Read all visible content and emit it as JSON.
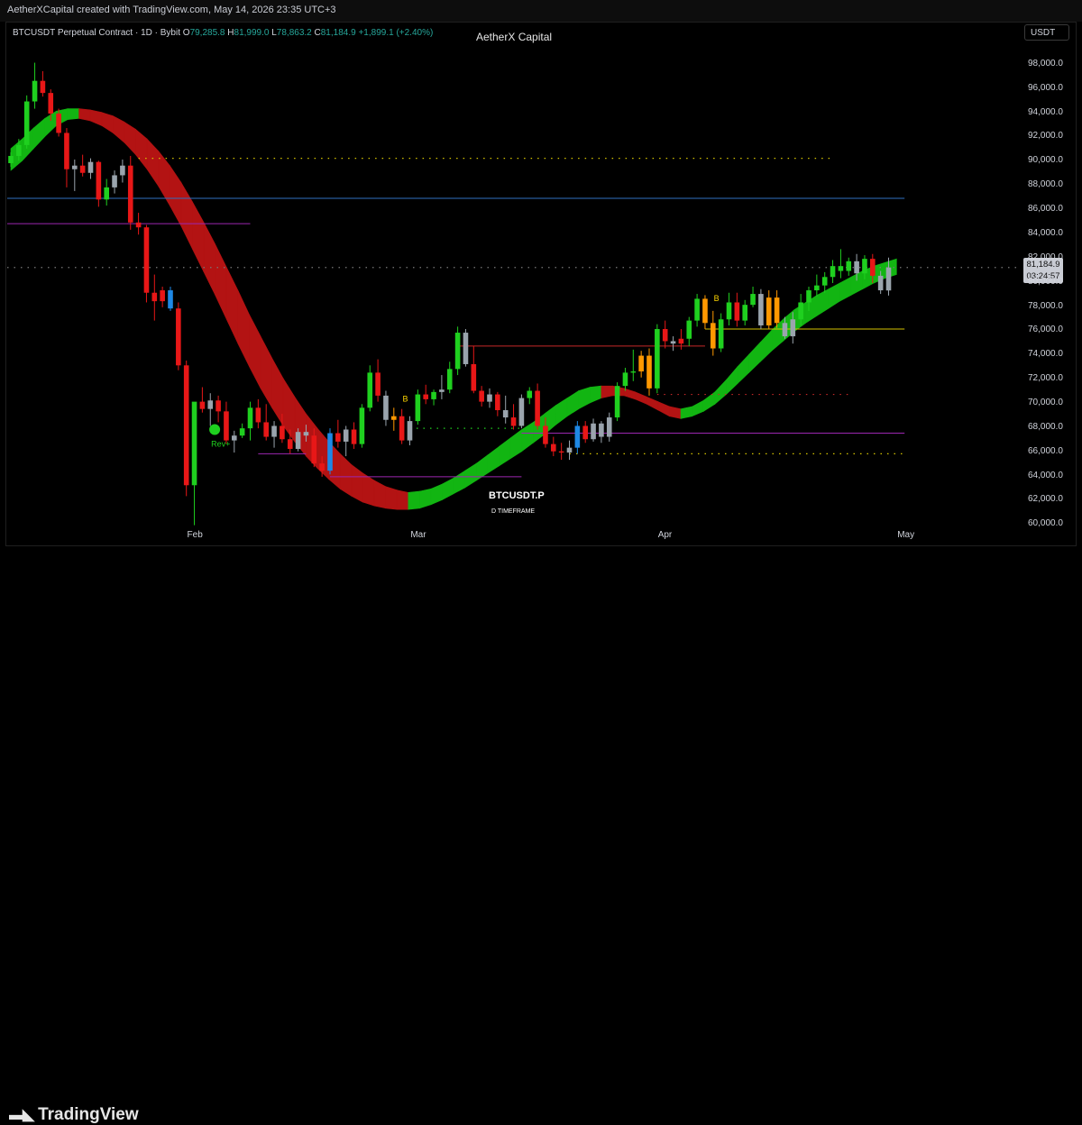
{
  "header": {
    "created_by": "AetherXCapital created with TradingView.com, May 14, 2026 23:35 UTC+3"
  },
  "legend": {
    "symbol": "BTCUSDT Perpetual Contract · 1D · Bybit",
    "open_label": "O",
    "open": "79,285.8",
    "high_label": "H",
    "high": "81,999.0",
    "low_label": "L",
    "low": "78,863.2",
    "close_label": "C",
    "close": "81,184.9",
    "change": "+1,899.1 (+2.40%)"
  },
  "watermark": {
    "brand": "AetherX Capital",
    "symbol": "BTCUSDT.P",
    "timeframe": "D TIMEFRAME"
  },
  "price_scale": {
    "currency": "USDT",
    "last_price": "81,184.9",
    "countdown": "03:24:57"
  },
  "footer": {
    "logo_text": "TradingView"
  },
  "colors": {
    "up": "#1fd01f",
    "down": "#e81717",
    "neutral": "#9aa4ad",
    "blue": "#1e88e5",
    "orange": "#ff9800",
    "ribbon_up": "#12b512",
    "ribbon_down": "#b31313",
    "resistance": "#2f6fbf",
    "purple": "#9c27b0",
    "yellow_dots": "#d4c200",
    "red_dots": "#c62828"
  },
  "chart_data": {
    "type": "candlestick",
    "ylim": [
      59200,
      100300
    ],
    "y_ticks": [
      60000,
      62000,
      64000,
      66000,
      68000,
      70000,
      72000,
      74000,
      76000,
      78000,
      80000,
      82000,
      84000,
      86000,
      88000,
      90000,
      92000,
      94000,
      96000,
      98000
    ],
    "y_tick_labels": [
      "60,000.0",
      "62,000.0",
      "64,000.0",
      "66,000.0",
      "68,000.0",
      "70,000.0",
      "72,000.0",
      "74,000.0",
      "76,000.0",
      "78,000.0",
      "80,000.0",
      "82,000.0",
      "84,000.0",
      "86,000.0",
      "88,000.0",
      "90,000.0",
      "92,000.0",
      "94,000.0",
      "96,000.0",
      "98,000.0"
    ],
    "x_ticks": [
      {
        "label": "Feb",
        "bar": 23
      },
      {
        "label": "Mar",
        "bar": 51
      },
      {
        "label": "Apr",
        "bar": 82
      },
      {
        "label": "May",
        "bar": 112
      }
    ],
    "candles": [
      [
        89800,
        90700,
        89500,
        90400,
        "up"
      ],
      [
        90400,
        91800,
        90000,
        91300,
        "up"
      ],
      [
        91300,
        95400,
        91000,
        94900,
        "up"
      ],
      [
        94900,
        98100,
        94300,
        96600,
        "up"
      ],
      [
        96600,
        97400,
        95300,
        95600,
        "down"
      ],
      [
        95600,
        95900,
        93300,
        93900,
        "down"
      ],
      [
        93900,
        94300,
        92000,
        92300,
        "down"
      ],
      [
        92300,
        92700,
        87800,
        89300,
        "down"
      ],
      [
        89300,
        90100,
        87500,
        89600,
        "neutral"
      ],
      [
        89600,
        90500,
        88700,
        89000,
        "down"
      ],
      [
        89000,
        90200,
        88500,
        89900,
        "neutral"
      ],
      [
        89900,
        90000,
        86200,
        86800,
        "down"
      ],
      [
        86800,
        88500,
        86300,
        87800,
        "up"
      ],
      [
        87800,
        89200,
        87300,
        88800,
        "neutral"
      ],
      [
        88800,
        90100,
        88200,
        89600,
        "neutral"
      ],
      [
        89600,
        90400,
        84300,
        84900,
        "down"
      ],
      [
        84900,
        85700,
        83900,
        84500,
        "down"
      ],
      [
        84500,
        84700,
        78300,
        79100,
        "down"
      ],
      [
        79100,
        80600,
        76800,
        78400,
        "down"
      ],
      [
        78400,
        79600,
        77900,
        79300,
        "down"
      ],
      [
        79300,
        79600,
        77600,
        77800,
        "blue"
      ],
      [
        77800,
        78300,
        72700,
        73100,
        "down"
      ],
      [
        73100,
        73500,
        62300,
        63200,
        "down"
      ],
      [
        63200,
        69900,
        59900,
        70100,
        "up"
      ],
      [
        70100,
        71300,
        69200,
        69500,
        "down"
      ],
      [
        69500,
        70800,
        68100,
        70200,
        "neutral"
      ],
      [
        70200,
        70600,
        68400,
        69300,
        "down"
      ],
      [
        69300,
        70100,
        66600,
        66900,
        "down"
      ],
      [
        66900,
        67700,
        65900,
        67300,
        "neutral"
      ],
      [
        67300,
        68300,
        67100,
        67900,
        "up"
      ],
      [
        67900,
        70100,
        66900,
        69600,
        "up"
      ],
      [
        69600,
        70300,
        67900,
        68400,
        "down"
      ],
      [
        68400,
        69900,
        66900,
        67200,
        "down"
      ],
      [
        67200,
        68500,
        66300,
        68100,
        "neutral"
      ],
      [
        68100,
        69100,
        66700,
        67000,
        "down"
      ],
      [
        67000,
        67800,
        65800,
        66200,
        "down"
      ],
      [
        66200,
        67900,
        66000,
        67600,
        "neutral"
      ],
      [
        67600,
        68200,
        66800,
        67300,
        "neutral"
      ],
      [
        67300,
        67900,
        64700,
        65000,
        "down"
      ],
      [
        65000,
        65600,
        63900,
        64400,
        "down"
      ],
      [
        64400,
        67900,
        64100,
        67500,
        "blue"
      ],
      [
        67500,
        68600,
        66300,
        66800,
        "down"
      ],
      [
        66800,
        68100,
        65600,
        67800,
        "neutral"
      ],
      [
        67800,
        68400,
        66200,
        66600,
        "down"
      ],
      [
        66600,
        69900,
        66300,
        69600,
        "up"
      ],
      [
        69600,
        73100,
        69300,
        72500,
        "up"
      ],
      [
        72500,
        73600,
        70100,
        70600,
        "down"
      ],
      [
        70600,
        71000,
        68100,
        68600,
        "neutral"
      ],
      [
        68600,
        69600,
        67700,
        68900,
        "orange"
      ],
      [
        68900,
        69500,
        66600,
        66900,
        "down"
      ],
      [
        66900,
        68900,
        66500,
        68500,
        "neutral"
      ],
      [
        68500,
        71100,
        68200,
        70700,
        "up"
      ],
      [
        70700,
        71500,
        69900,
        70300,
        "down"
      ],
      [
        70300,
        71100,
        69800,
        70900,
        "up"
      ],
      [
        70900,
        72300,
        70300,
        71100,
        "neutral"
      ],
      [
        71100,
        73400,
        70800,
        72800,
        "up"
      ],
      [
        72800,
        76300,
        72300,
        75800,
        "up"
      ],
      [
        75800,
        76100,
        73000,
        73200,
        "neutral"
      ],
      [
        73200,
        74700,
        70800,
        71000,
        "down"
      ],
      [
        71000,
        71400,
        69700,
        70100,
        "down"
      ],
      [
        70100,
        71200,
        69600,
        70700,
        "neutral"
      ],
      [
        70700,
        70900,
        68900,
        69400,
        "down"
      ],
      [
        69400,
        70600,
        68300,
        68800,
        "neutral"
      ],
      [
        68800,
        69900,
        67800,
        68100,
        "down"
      ],
      [
        68100,
        70700,
        67900,
        70400,
        "neutral"
      ],
      [
        70400,
        71300,
        69900,
        71000,
        "up"
      ],
      [
        71000,
        71600,
        67800,
        68100,
        "down"
      ],
      [
        68100,
        68800,
        66300,
        66600,
        "down"
      ],
      [
        66600,
        67200,
        65600,
        66000,
        "down"
      ],
      [
        66000,
        66700,
        65300,
        65900,
        "down"
      ],
      [
        65900,
        66900,
        65300,
        66300,
        "neutral"
      ],
      [
        66300,
        68500,
        65800,
        68100,
        "blue"
      ],
      [
        68100,
        68500,
        66700,
        67000,
        "down"
      ],
      [
        67000,
        68700,
        66800,
        68300,
        "neutral"
      ],
      [
        68300,
        68500,
        66700,
        67200,
        "neutral"
      ],
      [
        67200,
        69200,
        66800,
        68800,
        "neutral"
      ],
      [
        68800,
        71700,
        68500,
        71400,
        "up"
      ],
      [
        71400,
        72900,
        71000,
        72500,
        "up"
      ],
      [
        72500,
        74400,
        71800,
        72600,
        "up"
      ],
      [
        72600,
        74300,
        72100,
        73900,
        "orange"
      ],
      [
        73900,
        74500,
        70600,
        71200,
        "orange"
      ],
      [
        71200,
        76500,
        70800,
        76100,
        "up"
      ],
      [
        76100,
        76800,
        74500,
        75100,
        "down"
      ],
      [
        75100,
        75500,
        74300,
        74900,
        "neutral"
      ],
      [
        74900,
        76100,
        74400,
        75300,
        "down"
      ],
      [
        75300,
        77100,
        74700,
        76800,
        "up"
      ],
      [
        76800,
        79000,
        76300,
        78600,
        "up"
      ],
      [
        78600,
        78900,
        76100,
        76600,
        "orange"
      ],
      [
        76600,
        77600,
        73900,
        74500,
        "orange"
      ],
      [
        74500,
        77400,
        74200,
        76900,
        "up"
      ],
      [
        76900,
        79100,
        76400,
        78300,
        "up"
      ],
      [
        78300,
        79100,
        76300,
        76800,
        "down"
      ],
      [
        76800,
        78500,
        76400,
        78100,
        "up"
      ],
      [
        78100,
        79600,
        77900,
        79000,
        "up"
      ],
      [
        79000,
        79400,
        76100,
        76400,
        "neutral"
      ],
      [
        76400,
        79300,
        76100,
        78700,
        "orange"
      ],
      [
        78700,
        79300,
        76200,
        76600,
        "orange"
      ],
      [
        76600,
        77100,
        75300,
        75500,
        "neutral"
      ],
      [
        75500,
        77500,
        74900,
        76900,
        "neutral"
      ],
      [
        76900,
        79000,
        76400,
        78300,
        "up"
      ],
      [
        78300,
        79600,
        77600,
        79300,
        "up"
      ],
      [
        79300,
        80600,
        78800,
        79700,
        "up"
      ],
      [
        79700,
        80800,
        79100,
        80400,
        "up"
      ],
      [
        80400,
        81800,
        79900,
        81300,
        "up"
      ],
      [
        81300,
        82700,
        80300,
        80900,
        "up"
      ],
      [
        80900,
        82000,
        80500,
        81700,
        "up"
      ],
      [
        81700,
        82300,
        80100,
        80700,
        "neutral"
      ],
      [
        80700,
        82200,
        80200,
        81900,
        "up"
      ],
      [
        81900,
        82300,
        79900,
        80500,
        "down"
      ],
      [
        80500,
        80900,
        79000,
        79300,
        "neutral"
      ],
      [
        79285.8,
        81999.0,
        78863.2,
        81184.9,
        "neutral"
      ]
    ],
    "ribbon": [
      [
        89200,
        91000,
        "up"
      ],
      [
        90000,
        91800,
        "up"
      ],
      [
        91000,
        92700,
        "up"
      ],
      [
        92000,
        93500,
        "up"
      ],
      [
        92900,
        94100,
        "up"
      ],
      [
        93400,
        94300,
        "up"
      ],
      [
        93500,
        94300,
        "down"
      ],
      [
        93300,
        94200,
        "down"
      ],
      [
        92900,
        94000,
        "down"
      ],
      [
        92300,
        93700,
        "down"
      ],
      [
        91500,
        93200,
        "down"
      ],
      [
        90500,
        92600,
        "down"
      ],
      [
        89300,
        91800,
        "down"
      ],
      [
        87900,
        90800,
        "down"
      ],
      [
        86300,
        89600,
        "down"
      ],
      [
        84600,
        88200,
        "down"
      ],
      [
        82700,
        86600,
        "down"
      ],
      [
        80800,
        84900,
        "down"
      ],
      [
        78900,
        83100,
        "down"
      ],
      [
        76900,
        81200,
        "down"
      ],
      [
        74900,
        79300,
        "down"
      ],
      [
        73000,
        77300,
        "down"
      ],
      [
        71200,
        75500,
        "down"
      ],
      [
        69600,
        73700,
        "down"
      ],
      [
        68100,
        72000,
        "down"
      ],
      [
        66800,
        70500,
        "down"
      ],
      [
        65600,
        69100,
        "down"
      ],
      [
        64600,
        67900,
        "down"
      ],
      [
        63700,
        66800,
        "down"
      ],
      [
        62900,
        65800,
        "down"
      ],
      [
        62300,
        64900,
        "down"
      ],
      [
        61800,
        64200,
        "down"
      ],
      [
        61500,
        63600,
        "down"
      ],
      [
        61300,
        63100,
        "down"
      ],
      [
        61200,
        62800,
        "down"
      ],
      [
        61200,
        62600,
        "up"
      ],
      [
        61300,
        62700,
        "up"
      ],
      [
        61600,
        62900,
        "up"
      ],
      [
        62000,
        63300,
        "up"
      ],
      [
        62500,
        63800,
        "up"
      ],
      [
        63000,
        64400,
        "up"
      ],
      [
        63600,
        65000,
        "up"
      ],
      [
        64200,
        65700,
        "up"
      ],
      [
        64800,
        66400,
        "up"
      ],
      [
        65400,
        67100,
        "up"
      ],
      [
        66000,
        67800,
        "up"
      ],
      [
        66700,
        68400,
        "up"
      ],
      [
        67400,
        69100,
        "up"
      ],
      [
        68200,
        69800,
        "up"
      ],
      [
        68900,
        70400,
        "up"
      ],
      [
        69500,
        71000,
        "up"
      ],
      [
        70000,
        71300,
        "up"
      ],
      [
        70400,
        71400,
        "down"
      ],
      [
        70600,
        71400,
        "down"
      ],
      [
        70600,
        71200,
        "down"
      ],
      [
        70300,
        70900,
        "down"
      ],
      [
        69900,
        70500,
        "down"
      ],
      [
        69400,
        70100,
        "down"
      ],
      [
        68900,
        69700,
        "down"
      ],
      [
        68700,
        69500,
        "up"
      ],
      [
        68900,
        69700,
        "up"
      ],
      [
        69300,
        70200,
        "up"
      ],
      [
        69900,
        70900,
        "up"
      ],
      [
        70700,
        71900,
        "up"
      ],
      [
        71600,
        73000,
        "up"
      ],
      [
        72500,
        74000,
        "up"
      ],
      [
        73400,
        75000,
        "up"
      ],
      [
        74300,
        76000,
        "up"
      ],
      [
        75100,
        76900,
        "up"
      ],
      [
        75900,
        77700,
        "up"
      ],
      [
        76600,
        78300,
        "up"
      ],
      [
        77200,
        78900,
        "up"
      ],
      [
        77800,
        79400,
        "up"
      ],
      [
        78400,
        79900,
        "up"
      ],
      [
        78900,
        80400,
        "up"
      ],
      [
        79400,
        80900,
        "up"
      ],
      [
        79900,
        81300,
        "up"
      ],
      [
        80300,
        81600,
        "up"
      ],
      [
        80600,
        81900,
        "up"
      ]
    ],
    "ribbon_start_bar": 0,
    "ribbon_end_bar": 111,
    "levels": [
      {
        "name": "blue-resistance",
        "price": 86900,
        "from_bar": -1,
        "to_bar": 112,
        "style": "solid",
        "color": "#2f6fbf"
      },
      {
        "name": "purple-upper",
        "price": 84800,
        "from_bar": -1,
        "to_bar": 30,
        "style": "solid",
        "color": "#9c27b0"
      },
      {
        "name": "yellow-dotted-top",
        "price": 90200,
        "from_bar": 16,
        "to_bar": 103,
        "style": "dotted",
        "color": "#d4c200"
      },
      {
        "name": "red-level",
        "price": 74700,
        "from_bar": 56,
        "to_bar": 87,
        "style": "solid",
        "color": "#c62828"
      },
      {
        "name": "yellow-mid",
        "price": 76100,
        "from_bar": 87,
        "to_bar": 112,
        "style": "solid",
        "color": "#d4c200"
      },
      {
        "name": "red-dotted",
        "price": 70700,
        "from_bar": 81,
        "to_bar": 105,
        "style": "dotted",
        "color": "#c62828"
      },
      {
        "name": "purple-low",
        "price": 67500,
        "from_bar": 64,
        "to_bar": 112,
        "style": "solid",
        "color": "#9c27b0"
      },
      {
        "name": "purple-left-low",
        "price": 65800,
        "from_bar": 31,
        "to_bar": 37,
        "style": "solid",
        "color": "#9c27b0"
      },
      {
        "name": "purple-bottom",
        "price": 63900,
        "from_bar": 40,
        "to_bar": 64,
        "style": "solid",
        "color": "#9c27b0"
      },
      {
        "name": "green-dotted",
        "price": 67900,
        "from_bar": 50,
        "to_bar": 64,
        "style": "dotted",
        "color": "#1fd01f"
      },
      {
        "name": "yellow-dotted-low",
        "price": 65800,
        "from_bar": 70,
        "to_bar": 112,
        "style": "dotted",
        "color": "#d4c200"
      },
      {
        "name": "price-line",
        "price": 81184.9,
        "from_bar": -1,
        "to_bar": 120,
        "style": "dotted",
        "color": "#7a7a7a"
      }
    ],
    "annotations": [
      {
        "text": "Rev+",
        "bar": 26,
        "price": 66400,
        "color": "#1fd01f"
      },
      {
        "text": "B",
        "bar": 50,
        "price": 70100,
        "color": "#ffd600"
      },
      {
        "text": "B",
        "bar": 89,
        "price": 78400,
        "color": "#ffd600"
      }
    ]
  }
}
